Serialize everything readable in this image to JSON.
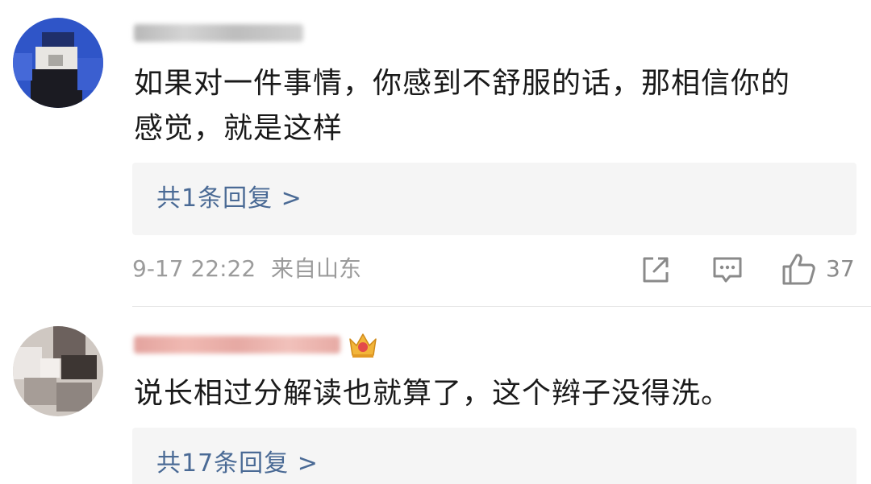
{
  "comments": [
    {
      "text_line1": "如果对一件事情，你感到不舒服的话，那相信你的",
      "text_line2": "感觉，就是这样",
      "replies_label": "共1条回复 >",
      "time": "9-17 22:22",
      "location": "来自山东",
      "like_count": "37"
    },
    {
      "text_line1": "说长相过分解读也就算了，这个辫子没得洗。",
      "replies_label": "共17条回复 >"
    }
  ],
  "colors": {
    "reply_link": "#4a6a95",
    "meta_gray": "#9b9b9b",
    "reply_box_bg": "#f5f5f5",
    "badge_gold": "#e8a52a"
  },
  "icons": [
    "share-icon",
    "comment-icon",
    "thumbs-up-icon",
    "crown-badge-icon"
  ]
}
